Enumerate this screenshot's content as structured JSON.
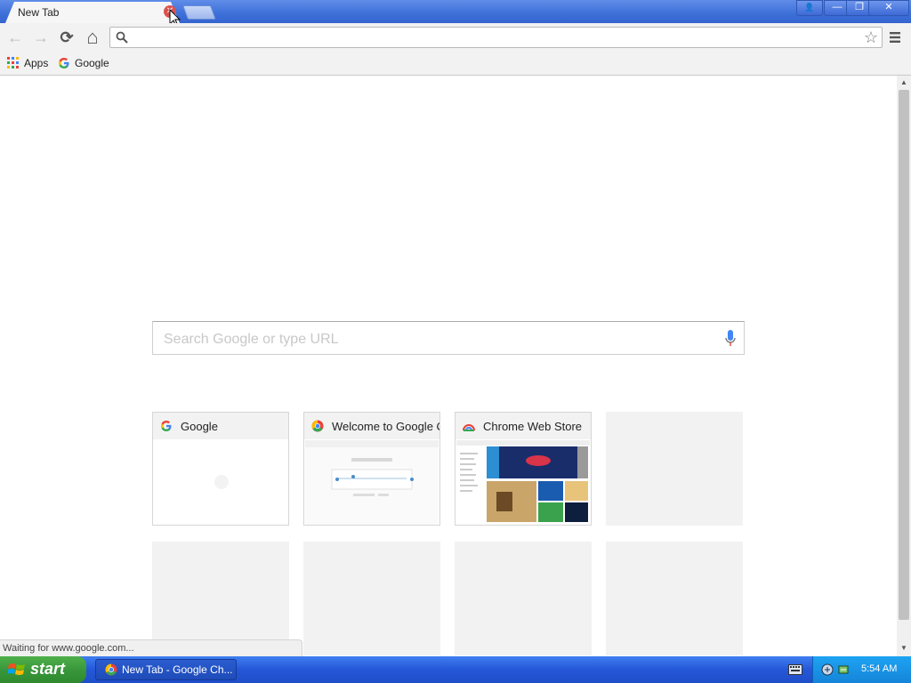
{
  "tab": {
    "title": "New Tab",
    "close_symbol": "✕"
  },
  "window_controls": {
    "user": "👤",
    "minimize": "—",
    "restore": "❐",
    "close": "✕"
  },
  "toolbar": {
    "back": "←",
    "forward": "→",
    "reload": "⟳",
    "home": "⌂",
    "star": "☆",
    "address_value": ""
  },
  "bookmarks": {
    "apps_label": "Apps",
    "google_label": "Google"
  },
  "ntp": {
    "search_placeholder": "Search Google or type URL",
    "tiles": [
      {
        "title": "Google"
      },
      {
        "title": "Welcome to Google C"
      },
      {
        "title": "Chrome Web Store"
      }
    ]
  },
  "status_text": "Waiting for www.google.com...",
  "taskbar": {
    "start_label": "start",
    "task_label": "New Tab - Google Ch...",
    "clock": "5:54 AM"
  },
  "colors": {
    "google_blue": "#4285F4",
    "google_red": "#EA4335",
    "google_yellow": "#FBBC05",
    "google_green": "#34A853"
  }
}
